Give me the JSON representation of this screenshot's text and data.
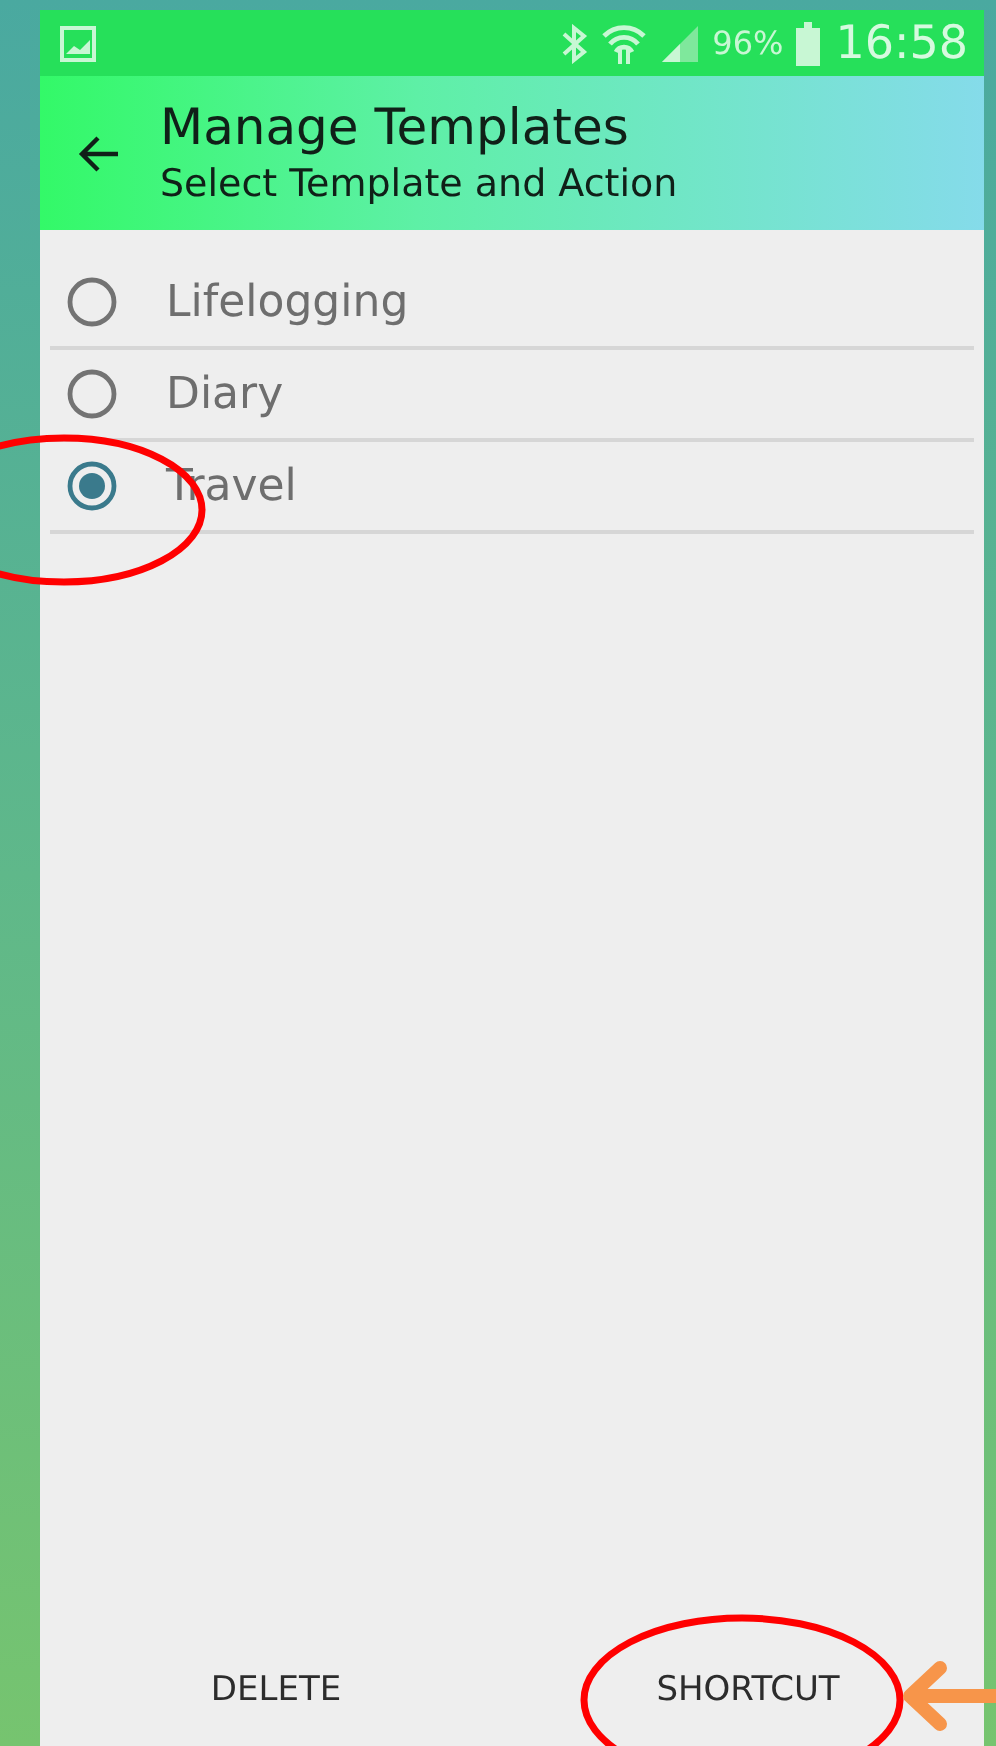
{
  "status_bar": {
    "battery": "96%",
    "time": "16:58"
  },
  "header": {
    "title": "Manage Templates",
    "subtitle": "Select Template and Action"
  },
  "templates": [
    {
      "label": "Lifelogging",
      "selected": false
    },
    {
      "label": "Diary",
      "selected": false
    },
    {
      "label": "Travel",
      "selected": true
    }
  ],
  "actions": [
    "DELETE",
    "SHORTCUT"
  ]
}
